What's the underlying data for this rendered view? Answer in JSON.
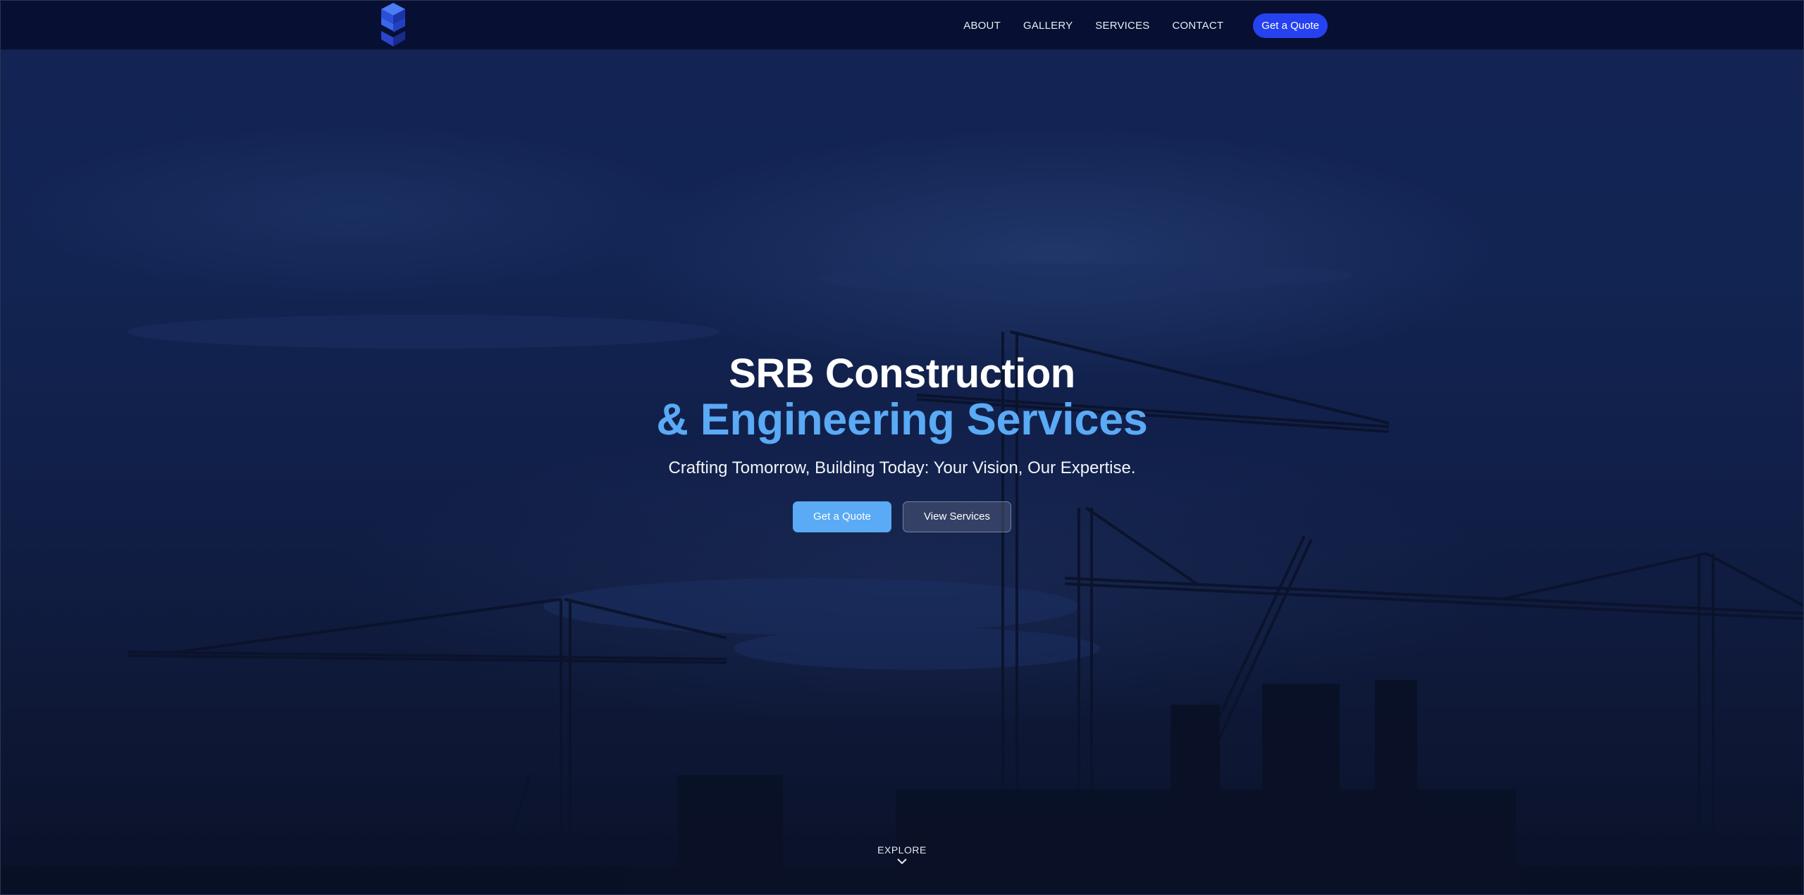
{
  "nav": {
    "logo_name": "srb-logo",
    "links": [
      "ABOUT",
      "GALLERY",
      "SERVICES",
      "CONTACT"
    ],
    "cta_label": "Get a Quote"
  },
  "hero": {
    "title_line1": "SRB Construction",
    "title_line2": "& Engineering Services",
    "subtitle": "Crafting Tomorrow, Building Today: Your Vision, Our Expertise.",
    "primary_button": "Get a Quote",
    "secondary_button": "View Services",
    "explore_label": "EXPLORE"
  },
  "colors": {
    "nav_bg": "#060e30",
    "accent_blue": "#2541f0",
    "title_highlight": "#5aaaf5",
    "hero_bg": "#122452"
  },
  "icons": {
    "logo": "srb-cube-logo",
    "explore": "chevron-down-icon"
  }
}
